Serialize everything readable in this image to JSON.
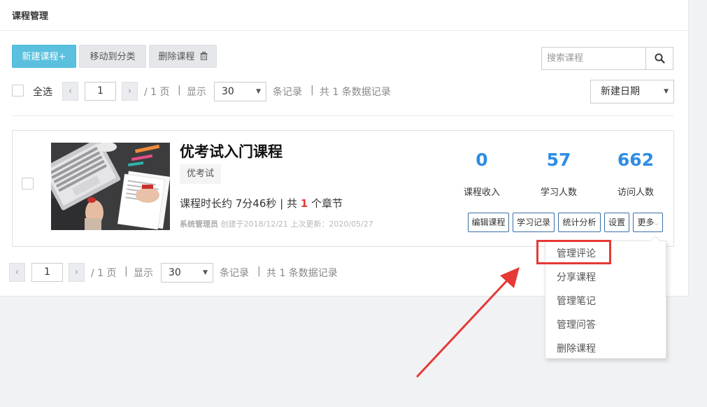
{
  "page": {
    "title": "课程管理"
  },
  "toolbar": {
    "new_course": "新建课程+",
    "move_to_category": "移动到分类",
    "delete_course": "删除课程",
    "search_placeholder": "搜索课程",
    "sort_selected": "新建日期"
  },
  "pagination_top": {
    "select_all": "全选",
    "page_value": "1",
    "page_total": "/ 1 页",
    "show_label": "显示",
    "page_size": "30",
    "records_label": "条记录",
    "total_text": "共 1 条数据记录",
    "divider": "|"
  },
  "course": {
    "title": "优考试入门课程",
    "tag": "优考试",
    "duration_prefix": "课程时长约 7分46秒 | 共",
    "chapter_count": "1",
    "duration_suffix": "个章节",
    "author": "系统管理员",
    "created": "创建于2018/12/21",
    "updated": "上次更新：2020/05/27",
    "stats": [
      {
        "value": "0",
        "label": "课程收入"
      },
      {
        "value": "57",
        "label": "学习人数"
      },
      {
        "value": "662",
        "label": "访问人数"
      }
    ],
    "actions": {
      "edit": "编辑课程",
      "records": "学习记录",
      "analysis": "统计分析",
      "settings": "设置",
      "more": "更多"
    }
  },
  "pagination_bottom": {
    "page_value": "1",
    "page_total": "/ 1 页",
    "show_label": "显示",
    "page_size": "30",
    "records_label": "条记录",
    "total_text": "共 1 条数据记录",
    "divider": "|"
  },
  "more_menu": {
    "items": [
      "管理评论",
      "分享课程",
      "管理笔记",
      "管理问答",
      "删除课程"
    ]
  },
  "colors": {
    "primary_button": "#5bc0de",
    "stat_number": "#2d8de6",
    "highlight": "#e53935",
    "action_border": "#3b6ea5"
  },
  "icons": [
    "search-icon",
    "trash-icon",
    "chevron-left-icon",
    "chevron-right-icon",
    "caret-down-icon",
    "pointer-arrow"
  ]
}
